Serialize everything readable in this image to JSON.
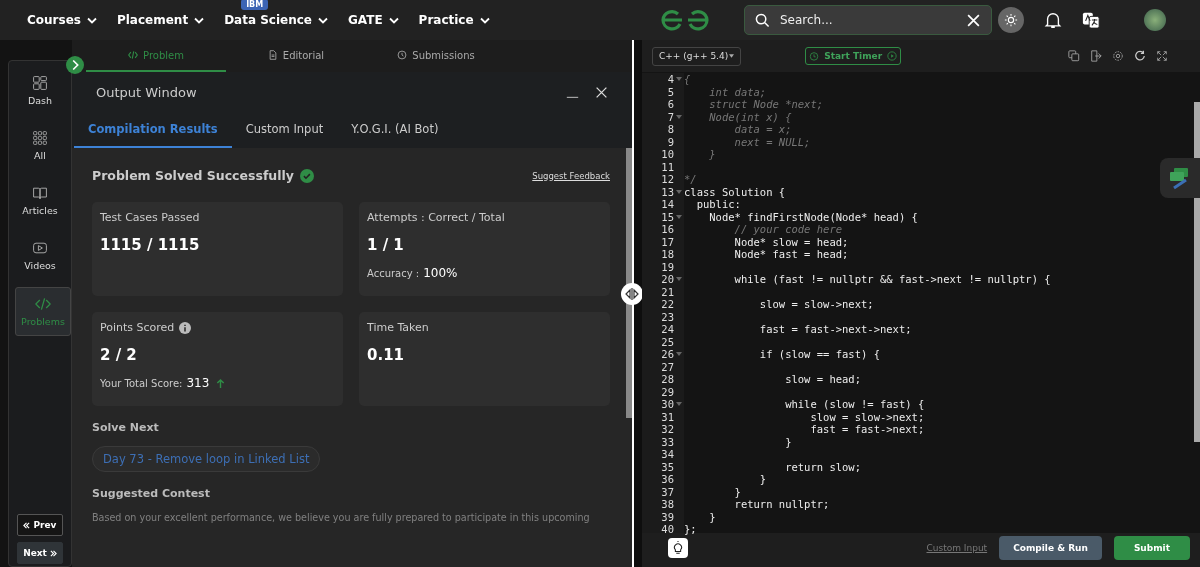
{
  "nav": {
    "items": [
      {
        "label": "Courses"
      },
      {
        "label": "Placement"
      },
      {
        "label": "Data Science",
        "badge": "IBM"
      },
      {
        "label": "GATE"
      },
      {
        "label": "Practice"
      }
    ],
    "search": {
      "placeholder": "Search..."
    }
  },
  "sidebar": {
    "items": [
      {
        "label": "Dash",
        "selected": false
      },
      {
        "label": "All",
        "selected": false
      },
      {
        "label": "Articles",
        "selected": false
      },
      {
        "label": "Videos",
        "selected": false
      },
      {
        "label": "Problems",
        "selected": true
      }
    ],
    "prev": "Prev",
    "next": "Next"
  },
  "problem_tabs": [
    {
      "label": "Problem",
      "selected": true
    },
    {
      "label": "Editorial",
      "selected": false
    },
    {
      "label": "Submissions",
      "selected": false
    }
  ],
  "output": {
    "title": "Output Window",
    "tabs": [
      {
        "label": "Compilation Results",
        "selected": true
      },
      {
        "label": "Custom Input",
        "selected": false
      },
      {
        "label": "Y.O.G.I. (AI Bot)",
        "selected": false
      }
    ],
    "status": "Problem Solved Successfully",
    "feedback": "Suggest Feedback",
    "cards": [
      {
        "title": "Test Cases Passed",
        "value": "1115 / 1115"
      },
      {
        "title": "Attempts : Correct / Total",
        "value": "1 / 1",
        "note_label": "Accuracy :",
        "note_value": "100%"
      },
      {
        "title": "Points Scored",
        "info": true,
        "value": "2 / 2",
        "note_label": "Your Total Score:",
        "note_value": "313"
      },
      {
        "title": "Time Taken",
        "value": "0.11"
      }
    ],
    "solve_next_title": "Solve Next",
    "solve_next": "Day 73 - Remove loop in Linked List",
    "contest_title": "Suggested Contest",
    "contest_text": "Based on your excellent performance, we believe you are fully prepared to participate in this upcoming"
  },
  "editor": {
    "language": "C++ (g++ 5.4)",
    "timer": "Start Timer",
    "lines": [
      {
        "no": "4",
        "text": "{",
        "kind": "comment",
        "fold": true
      },
      {
        "no": "5",
        "text": "    int data;",
        "kind": "comment",
        "fold": false
      },
      {
        "no": "6",
        "text": "    struct Node *next;",
        "kind": "comment",
        "fold": false
      },
      {
        "no": "7",
        "text": "    Node(int x) {",
        "kind": "comment",
        "fold": true
      },
      {
        "no": "8",
        "text": "        data = x;",
        "kind": "comment",
        "fold": false
      },
      {
        "no": "9",
        "text": "        next = NULL;",
        "kind": "comment",
        "fold": false
      },
      {
        "no": "10",
        "text": "    }",
        "kind": "comment",
        "fold": false
      },
      {
        "no": "11",
        "fold": false
      },
      {
        "no": "12",
        "text": "*/",
        "kind": "comment",
        "fold": false
      },
      {
        "no": "13",
        "text": "class Solution {",
        "kind": "code",
        "fold": true
      },
      {
        "no": "14",
        "text": "  public:",
        "kind": "code",
        "fold": false
      },
      {
        "no": "15",
        "text": "    Node* findFirstNode(Node* head) {",
        "kind": "code",
        "fold": true
      },
      {
        "no": "16",
        "text": "        // your code here",
        "kind": "comment",
        "fold": false
      },
      {
        "no": "17",
        "text": "        Node* slow = head;",
        "kind": "code",
        "fold": false
      },
      {
        "no": "18",
        "text": "        Node* fast = head;",
        "kind": "code",
        "fold": false
      },
      {
        "no": "19",
        "fold": false
      },
      {
        "no": "20",
        "text": "        while (fast != nullptr && fast->next != nullptr) {",
        "kind": "code",
        "fold": true
      },
      {
        "no": "21",
        "fold": false
      },
      {
        "no": "22",
        "text": "            slow = slow->next;",
        "kind": "code",
        "fold": false
      },
      {
        "no": "23",
        "fold": false
      },
      {
        "no": "24",
        "text": "            fast = fast->next->next;",
        "kind": "code",
        "fold": false
      },
      {
        "no": "25",
        "fold": false
      },
      {
        "no": "26",
        "text": "            if (slow == fast) {",
        "kind": "code",
        "fold": true
      },
      {
        "no": "27",
        "fold": false
      },
      {
        "no": "28",
        "text": "                slow = head;",
        "kind": "code",
        "fold": false
      },
      {
        "no": "29",
        "fold": false
      },
      {
        "no": "30",
        "text": "                while (slow != fast) {",
        "kind": "code",
        "fold": true
      },
      {
        "no": "31",
        "text": "                    slow = slow->next;",
        "kind": "code",
        "fold": false
      },
      {
        "no": "32",
        "text": "                    fast = fast->next;",
        "kind": "code",
        "fold": false
      },
      {
        "no": "33",
        "text": "                }",
        "kind": "code",
        "fold": false
      },
      {
        "no": "34",
        "fold": false
      },
      {
        "no": "35",
        "text": "                return slow;",
        "kind": "code",
        "fold": false
      },
      {
        "no": "36",
        "text": "            }",
        "kind": "code",
        "fold": false
      },
      {
        "no": "37",
        "text": "        }",
        "kind": "code",
        "fold": false
      },
      {
        "no": "38",
        "text": "        return nullptr;",
        "kind": "code",
        "fold": false
      },
      {
        "no": "39",
        "text": "    }",
        "kind": "code",
        "fold": false
      },
      {
        "no": "40",
        "text": "};",
        "kind": "code",
        "fold": false
      }
    ],
    "custom_input": "Custom Input",
    "compile": "Compile & Run",
    "submit": "Submit"
  }
}
